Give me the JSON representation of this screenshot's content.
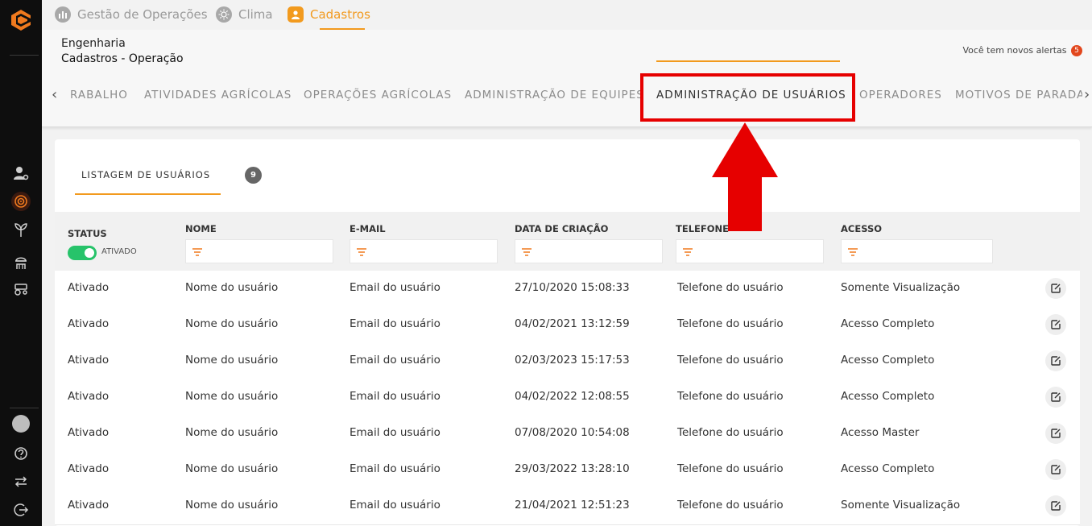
{
  "top_nav": {
    "items": [
      {
        "label": "Gestão de Operações",
        "icon": "chart-icon",
        "active": false
      },
      {
        "label": "Clima",
        "icon": "sun-icon",
        "active": false
      },
      {
        "label": "Cadastros",
        "icon": "user-icon",
        "active": true
      }
    ]
  },
  "header": {
    "department": "Engenharia",
    "page_title": "Cadastros - Operação",
    "alerts_text": "Você tem novos alertas",
    "alerts_badge": "5"
  },
  "tabs": {
    "prev_arrow": "‹",
    "next_arrow": "›",
    "items": [
      "RABALHO",
      "ATIVIDADES AGRÍCOLAS",
      "OPERAÇÕES AGRÍCOLAS",
      "ADMINISTRAÇÃO DE EQUIPES",
      "ADMINISTRAÇÃO DE USUÁRIOS",
      "OPERADORES",
      "MOTIVOS DE PARADA"
    ],
    "active": "ADMINISTRAÇÃO DE USUÁRIOS"
  },
  "listing": {
    "subtab_label": "LISTAGEM DE USUÁRIOS",
    "count": "9"
  },
  "table": {
    "columns": {
      "status": "STATUS",
      "nome": "NOME",
      "email": "E-MAIL",
      "data": "DATA DE CRIAÇÃO",
      "telefone": "TELEFONE",
      "acesso": "ACESSO"
    },
    "status_toggle_label": "ATIVADO",
    "rows": [
      {
        "status": "Ativado",
        "nome": "Nome do usuário",
        "email": "Email do usuário",
        "data": "27/10/2020 15:08:33",
        "telefone": "Telefone do usuário",
        "acesso": "Somente Visualização"
      },
      {
        "status": "Ativado",
        "nome": "Nome do usuário",
        "email": "Email do usuário",
        "data": "04/02/2021 13:12:59",
        "telefone": "Telefone do usuário",
        "acesso": "Acesso Completo"
      },
      {
        "status": "Ativado",
        "nome": "Nome do usuário",
        "email": "Email do usuário",
        "data": "02/03/2023 15:17:53",
        "telefone": "Telefone do usuário",
        "acesso": "Acesso Completo"
      },
      {
        "status": "Ativado",
        "nome": "Nome do usuário",
        "email": "Email do usuário",
        "data": "04/02/2022 12:08:55",
        "telefone": "Telefone do usuário",
        "acesso": "Acesso Completo"
      },
      {
        "status": "Ativado",
        "nome": "Nome do usuário",
        "email": "Email do usuário",
        "data": "07/08/2020 10:54:08",
        "telefone": "Telefone do usuário",
        "acesso": "Acesso Master"
      },
      {
        "status": "Ativado",
        "nome": "Nome do usuário",
        "email": "Email do usuário",
        "data": "29/03/2022 13:28:10",
        "telefone": "Telefone do usuário",
        "acesso": "Acesso Completo"
      },
      {
        "status": "Ativado",
        "nome": "Nome do usuário",
        "email": "Email do usuário",
        "data": "21/04/2021 12:51:23",
        "telefone": "Telefone do usuário",
        "acesso": "Somente Visualização"
      }
    ]
  },
  "colors": {
    "accent": "#f29a1e",
    "sidebar": "#0e0e0e",
    "toggle_on": "#27c36a",
    "annotation_red": "#e60000"
  }
}
